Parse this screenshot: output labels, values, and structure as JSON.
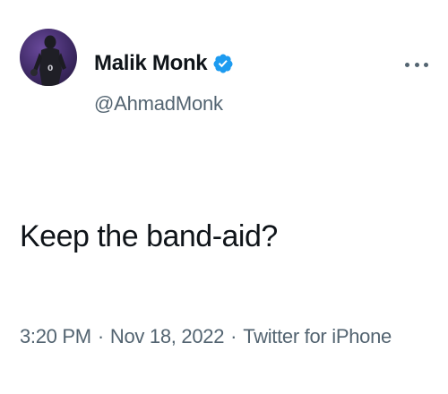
{
  "author": {
    "display_name": "Malik Monk",
    "handle": "@AhmadMonk",
    "verified": true,
    "verified_color": "#1d9bf0"
  },
  "tweet": {
    "text": "Keep the band-aid?",
    "time": "3:20 PM",
    "date": "Nov 18, 2022",
    "source": "Twitter for iPhone",
    "separator": "·"
  },
  "icons": {
    "verified": "verified-badge-icon",
    "more": "more-options-icon"
  }
}
